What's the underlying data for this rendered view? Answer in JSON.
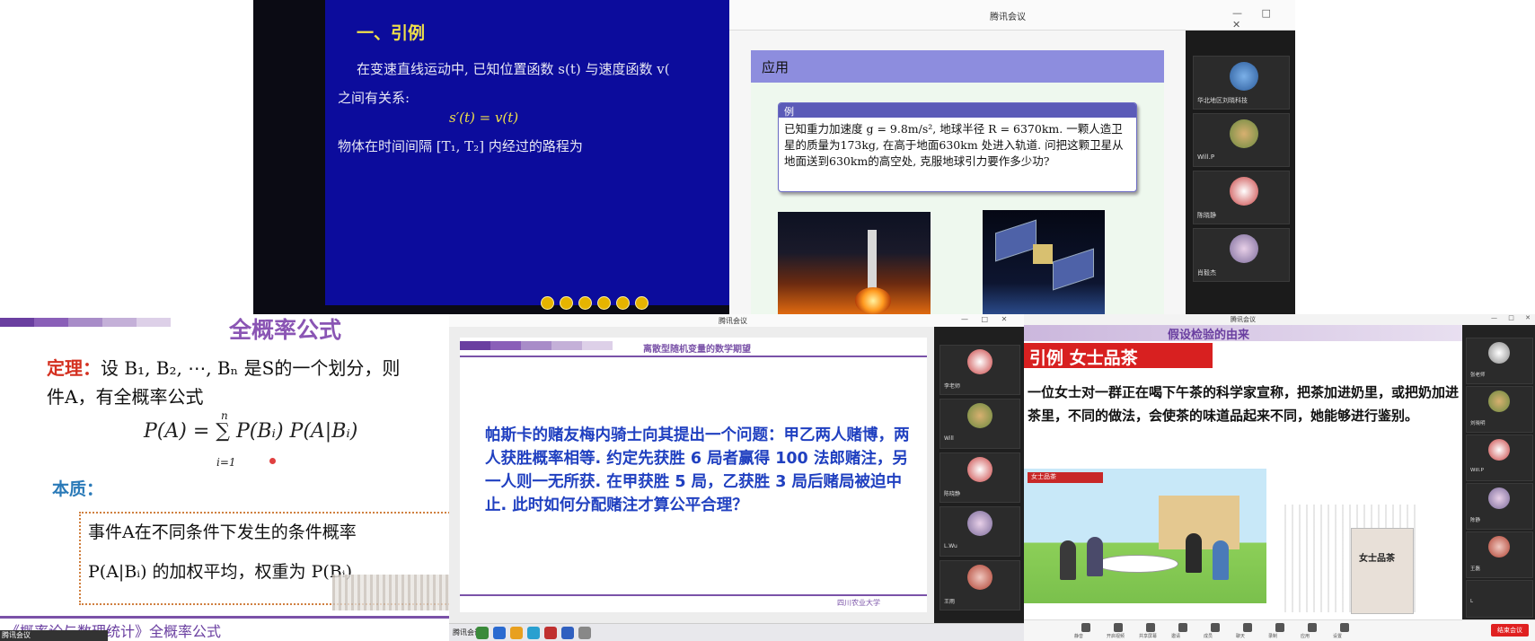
{
  "panel1": {
    "title": "一、引例",
    "line1": "在变速直线运动中, 已知位置函数 s(t) 与速度函数 v(",
    "line2": "之间有关系:",
    "formula": "s′(t) = v(t)",
    "line3": "物体在时间间隔 [T₁, T₂] 内经过的路程为"
  },
  "panel2": {
    "window_title": "腾讯会议",
    "window_controls": "— □ ✕",
    "slide_heading": "应用",
    "example_label": "例",
    "example_text": "已知重力加速度 g = 9.8m/s², 地球半径 R = 6370km. 一颗人造卫星的质量为173kg, 在高于地面630km 处进入轨道. 问把这颗卫星从地面送到630km的高空处, 克服地球引力要作多少功?",
    "participants": [
      "华北地区刘晓科技",
      "Will.P",
      "陈晓静",
      "肖毅杰"
    ]
  },
  "panel3": {
    "title": "全概率公式",
    "theorem_label": "定理：",
    "theorem_line1": "设 B₁, B₂, ⋯, Bₙ 是S的一个划分，则",
    "theorem_line2": "件A，有全概率公式",
    "formula": "P(A) = ∑ P(Bᵢ) P(A|Bᵢ)",
    "sum_upper": "n",
    "sum_lower": "i=1",
    "essence_label": "本质：",
    "box_line1": "事件A在不同条件下发生的条件概率",
    "box_line2": "P(A|Bᵢ) 的加权平均，权重为 P(Bᵢ)",
    "footer": "《概率论与数理统计》全概率公式",
    "taskbar_text": "腾讯会议"
  },
  "panel4": {
    "window_title": "腾讯会议",
    "window_controls": "— □ ✕",
    "slide_title": "离散型随机变量的数学期望",
    "body": "帕斯卡的赌友梅内骑士向其提出一个问题：甲乙两人赌博，两人获胜概率相等. 约定先获胜 6 局者赢得 100 法郎赌注，另一人则一无所获. 在甲获胜 5 局，乙获胜 3 局后赌局被迫中止. 此时如何分配赌注才算公平合理？",
    "logo_text": "四川农业大学",
    "taskbar_text": "腾讯会议",
    "participants": [
      "李老师",
      "Will",
      "陈晓静",
      "L.Wu",
      "王雨"
    ]
  },
  "panel5": {
    "window_title": "腾讯会议",
    "window_controls": "— □ ✕",
    "slide_title": "假设检验的由来",
    "banner": "引例   女士品茶",
    "body": "一位女士对一群正在喝下午茶的科学家宣称，把茶加进奶里，或把奶加进茶里，不同的做法，会使茶的味道品起来不同，她能够进行鉴别。",
    "scene_tag": "女士品茶",
    "book_title": "女士品茶",
    "participants": [
      "张老师",
      "刘晓明",
      "Will.P",
      "陈静",
      "王磊",
      "L"
    ],
    "toolbar_items": [
      "静音",
      "开启视频",
      "共享屏幕",
      "邀请",
      "成员",
      "聊天",
      "录制",
      "应用",
      "设置"
    ],
    "end_button": "结束会议"
  },
  "colors": {
    "blue_slide": "#0c0c9c",
    "yellow_text": "#f0e04a",
    "purple_accent": "#7a52a8",
    "red_accent": "#d82020",
    "body_blue": "#2040c0"
  }
}
